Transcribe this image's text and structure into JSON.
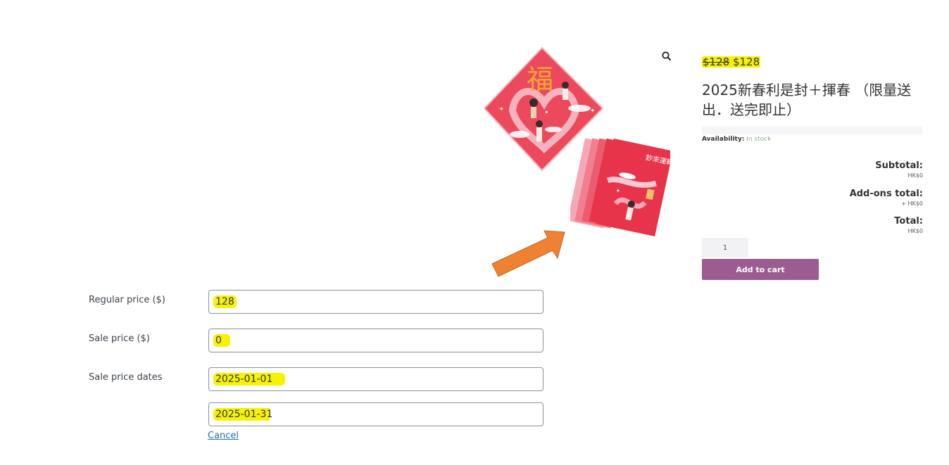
{
  "product": {
    "price_old": "$128",
    "price_new": "$128",
    "title": "2025新春利是封＋揮春 （限量送出．送完即止）",
    "availability_label": "Availability:",
    "availability_value": "In stock",
    "subtotal_label": "Subtotal:",
    "subtotal_value": "HK$0",
    "addons_label": "Add-ons total:",
    "addons_value": "+ HK$0",
    "total_label": "Total:",
    "total_value": "HK$0",
    "quantity": "1",
    "add_to_cart_label": "Add to cart",
    "fu_character": "福",
    "envelope_text": "鈔來運轉"
  },
  "form": {
    "regular_price_label": "Regular price ($)",
    "regular_price_value": "128",
    "sale_price_label": "Sale price ($)",
    "sale_price_value": "0",
    "sale_dates_label": "Sale price dates",
    "sale_date_from": "2025-01-01",
    "sale_date_to": "2025-01-31",
    "cancel_label": "Cancel"
  },
  "colors": {
    "highlight": "#f7f200",
    "add_to_cart_bg": "#9b5c8f",
    "arrow": "#ef8232",
    "envelope_red": "#e8344a"
  },
  "icons": [
    "magnifier-zoom-icon",
    "orange-arrow-annotation"
  ]
}
